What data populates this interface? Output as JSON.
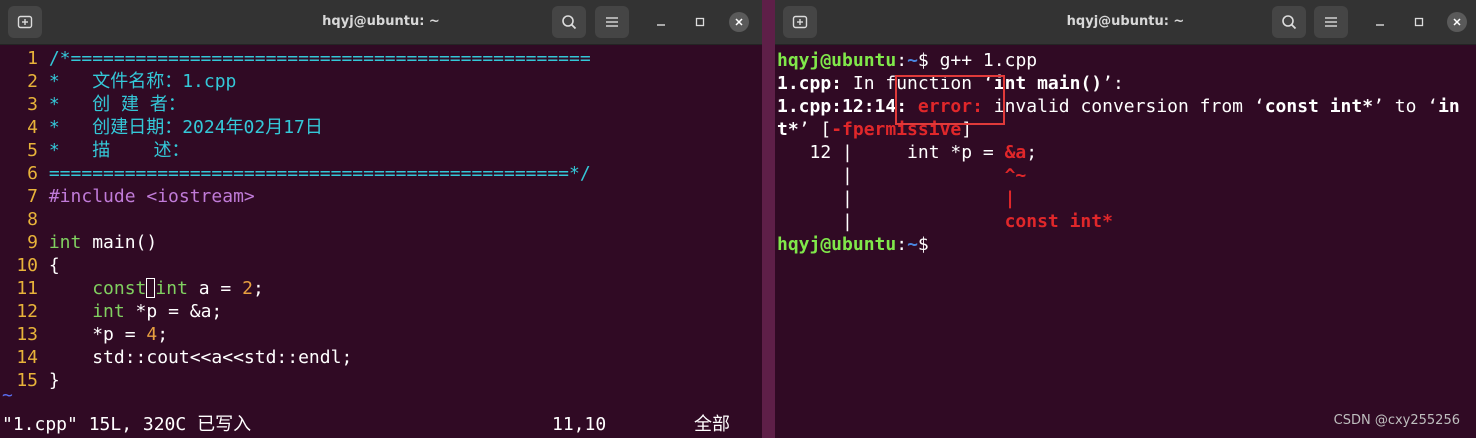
{
  "left_window": {
    "title": "hqyj@ubuntu: ~",
    "buttons": {
      "new_tab": "⊞",
      "search": "🔍",
      "menu": "≡",
      "minimize": "–",
      "maximize": "□",
      "close": "×"
    },
    "code": [
      {
        "n": "1",
        "parts": [
          [
            "c-comment",
            "/*================================================"
          ]
        ]
      },
      {
        "n": "2",
        "parts": [
          [
            "c-comment",
            "*   文件名称：1.cpp"
          ]
        ]
      },
      {
        "n": "3",
        "parts": [
          [
            "c-comment",
            "*   创 建 者："
          ]
        ]
      },
      {
        "n": "4",
        "parts": [
          [
            "c-comment",
            "*   创建日期：2024年02月17日"
          ]
        ]
      },
      {
        "n": "5",
        "parts": [
          [
            "c-comment",
            "*   描    述："
          ]
        ]
      },
      {
        "n": "6",
        "parts": [
          [
            "c-comment",
            "================================================*/"
          ]
        ]
      },
      {
        "n": "7",
        "parts": [
          [
            "c-pre",
            "#include <iostream>"
          ]
        ]
      },
      {
        "n": "8",
        "parts": []
      },
      {
        "n": "9",
        "parts": [
          [
            "c-type",
            "int"
          ],
          [
            "c-txt",
            " main()"
          ]
        ]
      },
      {
        "n": "10",
        "parts": [
          [
            "c-txt",
            "{"
          ]
        ]
      },
      {
        "n": "11",
        "parts": [
          [
            "c-txt",
            "    "
          ],
          [
            "c-type",
            "const"
          ],
          [
            "cursor",
            ""
          ],
          [
            "c-type",
            "int"
          ],
          [
            "c-txt",
            " a = "
          ],
          [
            "c-num",
            "2"
          ],
          [
            "c-txt",
            ";"
          ]
        ]
      },
      {
        "n": "12",
        "parts": [
          [
            "c-txt",
            "    "
          ],
          [
            "c-type",
            "int"
          ],
          [
            "c-txt",
            " *p = &a;"
          ]
        ]
      },
      {
        "n": "13",
        "parts": [
          [
            "c-txt",
            "    *p = "
          ],
          [
            "c-num",
            "4"
          ],
          [
            "c-txt",
            ";"
          ]
        ]
      },
      {
        "n": "14",
        "parts": [
          [
            "c-txt",
            "    std::cout<<a<<std::endl;"
          ]
        ]
      },
      {
        "n": "15",
        "parts": [
          [
            "c-txt",
            "}"
          ]
        ]
      }
    ],
    "tilde": "~",
    "status_left": "\"1.cpp\" 15L, 320C 已写入",
    "status_pos": "11,10",
    "status_right": "全部"
  },
  "right_window": {
    "title": "hqyj@ubuntu: ~",
    "buttons": {
      "new_tab": "⊞",
      "search": "🔍",
      "menu": "≡",
      "minimize": "–",
      "maximize": "□",
      "close": "×"
    },
    "lines": [
      [
        [
          "c-green",
          "hqyj@ubuntu"
        ],
        [
          "c-txt",
          ":"
        ],
        [
          "c-blue",
          "~"
        ],
        [
          "c-txt",
          "$ g++ 1.cpp"
        ]
      ],
      [
        [
          "c-bold",
          "1.cpp:"
        ],
        [
          "c-txt",
          " In function ‘"
        ],
        [
          "c-bold",
          "int main()"
        ],
        [
          "c-txt",
          "’:"
        ]
      ],
      [
        [
          "c-bold",
          "1.cpp:12:14:"
        ],
        [
          "c-txt",
          " "
        ],
        [
          "c-red",
          "error:"
        ],
        [
          "c-txt",
          " invalid conversion from ‘"
        ],
        [
          "c-bold",
          "const int*"
        ],
        [
          "c-txt",
          "’ to ‘"
        ],
        [
          "c-bold",
          "in"
        ]
      ],
      [
        [
          "c-bold",
          "t*"
        ],
        [
          "c-txt",
          "’ ["
        ],
        [
          "c-red",
          "-fpermissive"
        ],
        [
          "c-txt",
          "]"
        ]
      ],
      [
        [
          "c-txt",
          "   12 |     int *p = "
        ],
        [
          "c-red",
          "&a"
        ],
        [
          "c-txt",
          ";"
        ]
      ],
      [
        [
          "c-txt",
          "      |              "
        ],
        [
          "c-red",
          "^~"
        ]
      ],
      [
        [
          "c-txt",
          "      |              "
        ],
        [
          "c-red",
          "|"
        ]
      ],
      [
        [
          "c-txt",
          "      |              "
        ],
        [
          "c-red",
          "const int*"
        ]
      ],
      [
        [
          "c-green",
          "hqyj@ubuntu"
        ],
        [
          "c-txt",
          ":"
        ],
        [
          "c-blue",
          "~"
        ],
        [
          "c-txt",
          "$ "
        ]
      ]
    ],
    "watermark": "CSDN @cxy255256"
  }
}
